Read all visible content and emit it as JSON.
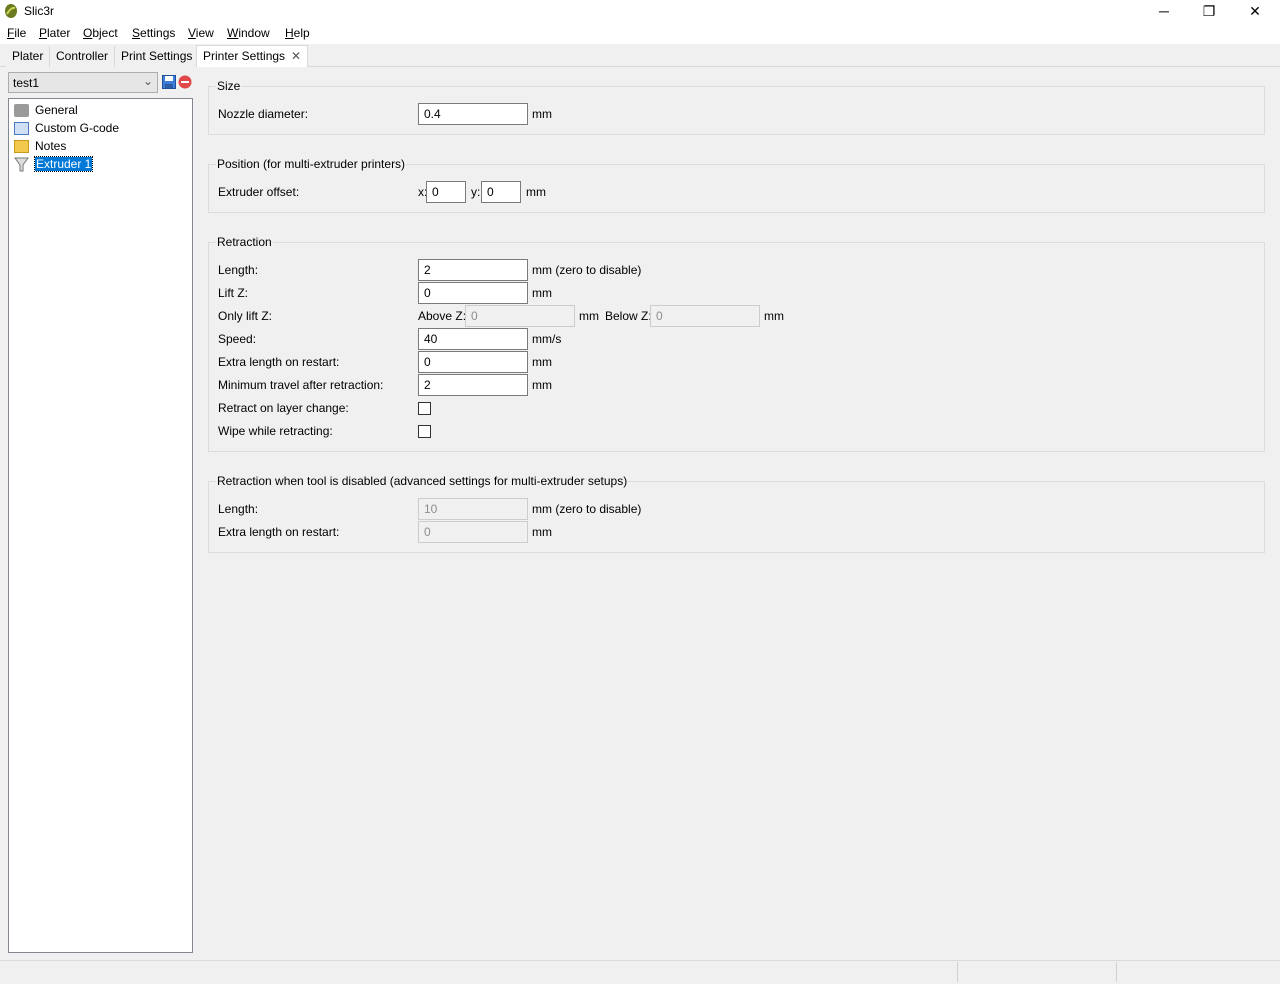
{
  "window": {
    "title": "Slic3r",
    "minimize": "─",
    "restore": "❐",
    "close": "✕"
  },
  "menu": [
    {
      "key": "F",
      "rest": "ile"
    },
    {
      "key": "P",
      "rest": "later"
    },
    {
      "key": "O",
      "rest": "bject"
    },
    {
      "key": "S",
      "rest": "ettings"
    },
    {
      "key": "V",
      "rest": "iew"
    },
    {
      "key": "W",
      "rest": "indow"
    },
    {
      "key": "H",
      "rest": "elp"
    }
  ],
  "tabs": [
    "Plater",
    "Controller",
    "Print Settings",
    "Printer Settings"
  ],
  "tab_close": "✕",
  "preset": {
    "value": "test1"
  },
  "tree": [
    "General",
    "Custom G-code",
    "Notes",
    "Extruder 1"
  ],
  "size": {
    "title": "Size",
    "nozzle_label": "Nozzle diameter:",
    "nozzle_value": "0.4",
    "unit": "mm"
  },
  "position": {
    "title": "Position (for multi-extruder printers)",
    "offset_label": "Extruder offset:",
    "x_label": "x:",
    "x_value": "0",
    "y_label": "y:",
    "y_value": "0",
    "unit": "mm"
  },
  "retraction": {
    "title": "Retraction",
    "length_label": "Length:",
    "length_value": "2",
    "length_unit": "mm (zero to disable)",
    "lift_label": "Lift Z:",
    "lift_value": "0",
    "lift_unit": "mm",
    "only_lift_label": "Only lift Z:",
    "above_label": "Above Z:",
    "above_value": "0",
    "above_unit": "mm",
    "below_label": "Below Z:",
    "below_value": "0",
    "below_unit": "mm",
    "speed_label": "Speed:",
    "speed_value": "40",
    "speed_unit": "mm/s",
    "extra_label": "Extra length on restart:",
    "extra_value": "0",
    "extra_unit": "mm",
    "mintravel_label": "Minimum travel after retraction:",
    "mintravel_value": "2",
    "mintravel_unit": "mm",
    "layer_change_label": "Retract on layer change:",
    "layer_change_checked": false,
    "wipe_label": "Wipe while retracting:",
    "wipe_checked": false
  },
  "disabled": {
    "title": "Retraction when tool is disabled (advanced settings for multi-extruder setups)",
    "length_label": "Length:",
    "length_value": "10",
    "length_unit": "mm (zero to disable)",
    "extra_label": "Extra length on restart:",
    "extra_value": "0",
    "extra_unit": "mm"
  }
}
